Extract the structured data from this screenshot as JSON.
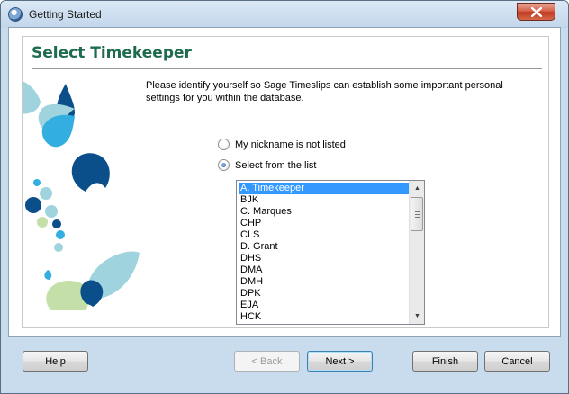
{
  "window": {
    "title": "Getting Started"
  },
  "page": {
    "title": "Select Timekeeper",
    "description": "Please identify yourself so Sage Timeslips can establish some important personal settings for you within the database."
  },
  "options": {
    "not_listed_label": "My nickname is not listed",
    "from_list_label": "Select from the list",
    "selected": "from_list"
  },
  "timekeepers": {
    "selected_index": 0,
    "items": [
      "A. Timekeeper",
      "BJK",
      "C. Marques",
      "CHP",
      "CLS",
      "D. Grant",
      "DHS",
      "DMA",
      "DMH",
      "DPK",
      "EJA",
      "HCK"
    ]
  },
  "buttons": {
    "help": "Help",
    "back": "< Back",
    "next": "Next >",
    "finish": "Finish",
    "cancel": "Cancel"
  },
  "colors": {
    "title_green": "#1e6b4e",
    "selection_blue": "#3399ff",
    "art_dark_blue": "#0a4f8a",
    "art_light_teal": "#9fd4de",
    "art_cyan": "#33aee0",
    "art_light_green": "#c4e0a8"
  }
}
